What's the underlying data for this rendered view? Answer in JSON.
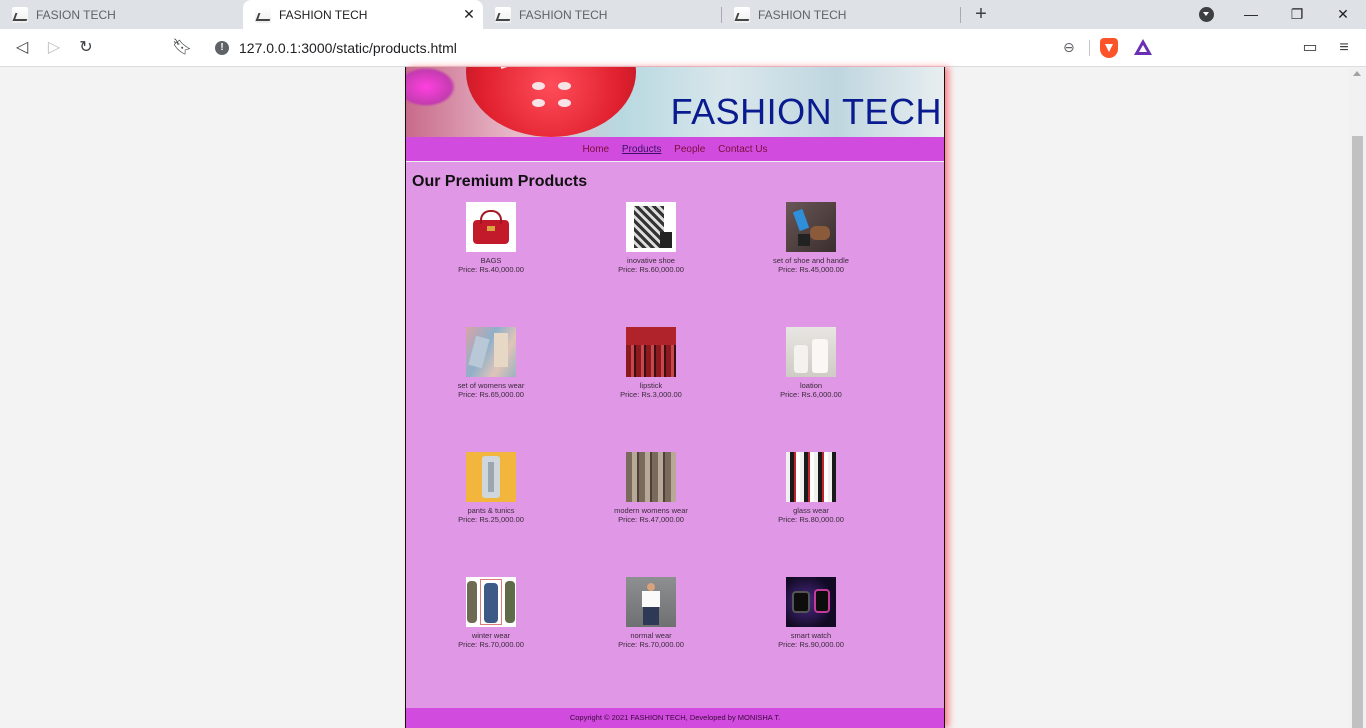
{
  "browser": {
    "tabs": [
      {
        "title": "FASION TECH",
        "active": false
      },
      {
        "title": "FASHION TECH",
        "active": true
      },
      {
        "title": "FASHION TECH",
        "active": false
      },
      {
        "title": "FASHION TECH",
        "active": false
      }
    ],
    "url": "127.0.0.1:3000/static/products.html"
  },
  "site": {
    "banner_title": "FASHION TECH",
    "nav": [
      "Home",
      "Products",
      "People",
      "Contact Us"
    ],
    "current_nav": "Products",
    "page_title": "Our Premium Products",
    "products": [
      {
        "name": "BAGS",
        "price": "Price: Rs.40,000.00",
        "thumb": "red-handbag"
      },
      {
        "name": "inovative shoe",
        "price": "Price: Rs.60,000.00",
        "thumb": "plaid-boot"
      },
      {
        "name": "set of shoe and handle",
        "price": "Price: Rs.45,000.00",
        "thumb": "shoe-set"
      },
      {
        "name": "set of womens wear",
        "price": "Price: Rs.65,000.00",
        "thumb": "womens-wear"
      },
      {
        "name": "lipstick",
        "price": "Price: Rs.3,000.00",
        "thumb": "lipstick"
      },
      {
        "name": "loation",
        "price": "Price: Rs.6,000.00",
        "thumb": "lotion"
      },
      {
        "name": "pants & tunics",
        "price": "Price: Rs.25,000.00",
        "thumb": "pants"
      },
      {
        "name": "modern womens wear",
        "price": "Price: Rs.47,000.00",
        "thumb": "modern-wear"
      },
      {
        "name": "glass wear",
        "price": "Price: Rs.80,000.00",
        "thumb": "glass-wear"
      },
      {
        "name": "winter wear",
        "price": "Price: Rs.70,000.00",
        "thumb": "winter-coats"
      },
      {
        "name": "normal wear",
        "price": "Price: Rs.70,000.00",
        "thumb": "man-casual"
      },
      {
        "name": "smart watch",
        "price": "Price: Rs.90,000.00",
        "thumb": "smart-watch"
      }
    ],
    "footer": "Copyright © 2021 FASHION TECH, Developed by MONISHA T."
  }
}
